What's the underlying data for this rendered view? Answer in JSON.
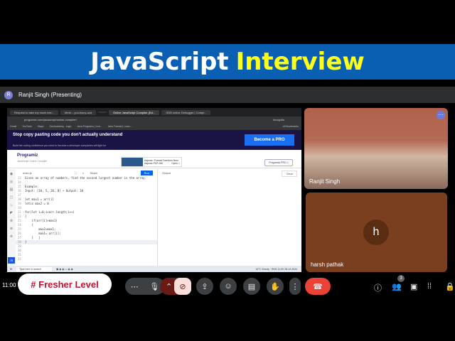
{
  "banner": {
    "title_white": "JavaScript",
    "title_yellow": "Interview"
  },
  "presenter": {
    "avatar": "R",
    "label": "Ranjit Singh (Presenting)"
  },
  "browser": {
    "tabs": [
      "Request to take my mock inte...",
      "Meet – yoo-bwuy-sza",
      "",
      "Online JavaScript Compiler (Ed...",
      "GDB online Debugger | Compi..."
    ],
    "url": "programiz.com/javascript/online-compiler/",
    "profile": "Incognito",
    "bookmarks": [
      "Gmail",
      "YouTube",
      "Maps",
      "Sai Academy - login",
      "Java Programs | Lea...",
      "Java Tutorial | Learn..."
    ],
    "all_bookmarks": "All Bookmarks"
  },
  "promo": {
    "title": "Stop copy pasting code you don't actually understand",
    "subtitle": "Build the coding confidence you need to become a developer companies will fight for",
    "button": "Become a PRO"
  },
  "site": {
    "logo": "Programiz",
    "subtitle": "JavaScript Online Compiler",
    "ad_text": "Aspose: Format Freedom Now",
    "ad_sub": "Aspose.PDF.JAV",
    "ad_open": "Open >",
    "pro_button": "Programiz PRO >"
  },
  "editor": {
    "file": "main.js",
    "share": "Share",
    "run": "Run",
    "output_label": "Output",
    "clear": "Clear",
    "lines": [
      {
        "n": "13",
        "t": "Given an array of numbers, find the second largest number in the array."
      },
      {
        "n": "14",
        "t": ""
      },
      {
        "n": "15",
        "t": "Example:"
      },
      {
        "n": "16",
        "t": "Input: [10, 5, 20, 8] → Output: 10"
      },
      {
        "n": "17",
        "t": ""
      },
      {
        "n": "18",
        "t": "let max1 = arr[i]"
      },
      {
        "n": "19",
        "t": "letis max2 = 0"
      },
      {
        "n": "20",
        "t": ""
      },
      {
        "n": "21",
        "t": "for(let i=0;i<arr.length;i++)"
      },
      {
        "n": "22",
        "t": "{"
      },
      {
        "n": "23",
        "t": "    if(arr[i]>max1)"
      },
      {
        "n": "24",
        "t": "    {"
      },
      {
        "n": "25",
        "t": "        max2=max1;"
      },
      {
        "n": "26",
        "t": "        max1= arr[i];"
      },
      {
        "n": "27",
        "t": "    }   |"
      },
      {
        "n": "28",
        "t": "}"
      },
      {
        "n": "29",
        "t": ""
      },
      {
        "n": "30",
        "t": ""
      },
      {
        "n": "31",
        "t": ""
      },
      {
        "n": "32",
        "t": ""
      }
    ]
  },
  "taskbar": {
    "search": "Type here to search",
    "weather": "14°C Cloudy",
    "lang": "ENG",
    "time": "11:00",
    "date": "28-12-2024"
  },
  "participants": [
    {
      "name": "Ranjit Singh"
    },
    {
      "name": "harsh pathak",
      "initial": "h"
    }
  ],
  "meeting": {
    "clock": "11:00",
    "tag": "# Fresher Level",
    "participant_count": "3"
  }
}
